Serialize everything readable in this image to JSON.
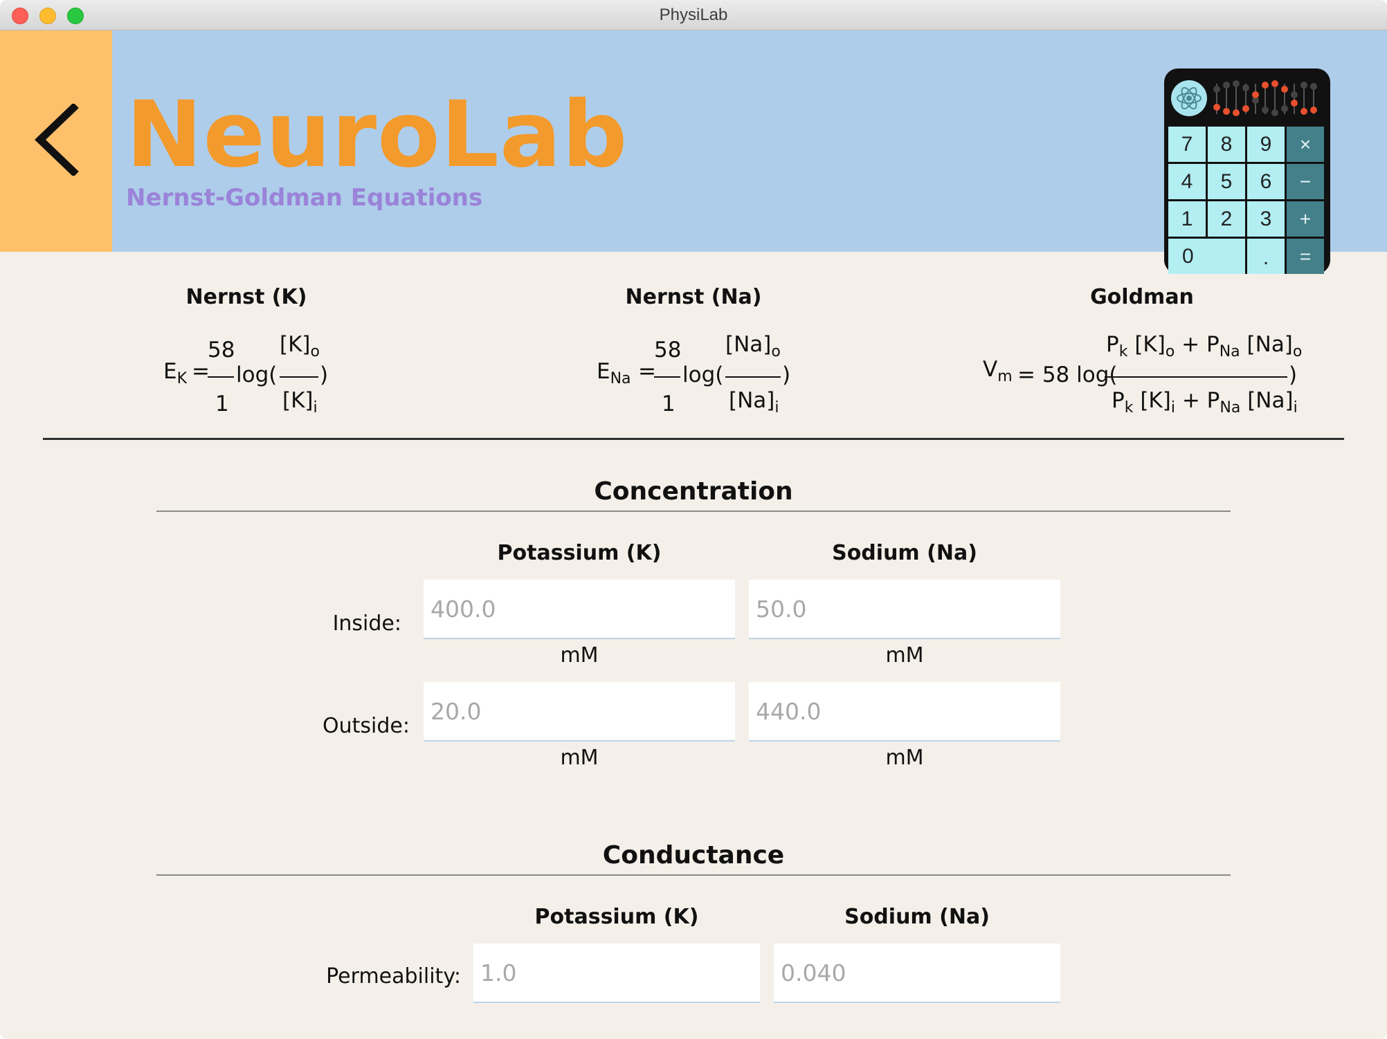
{
  "window": {
    "title": "PhysiLab"
  },
  "header": {
    "app_title": "NeuroLab",
    "subtitle": "Nernst-Goldman Equations",
    "back_icon": "chevron-left-icon",
    "colors": {
      "header_bg": "#aecdea",
      "back_bg": "#fec06b",
      "title": "#f39a2c",
      "subtitle": "#9a83d8"
    }
  },
  "calculator": {
    "icon": "calculator-icon",
    "keys": [
      [
        "7",
        "8",
        "9",
        "×"
      ],
      [
        "4",
        "5",
        "6",
        "−"
      ],
      [
        "1",
        "2",
        "3",
        "+"
      ],
      [
        "0",
        ".",
        "="
      ]
    ]
  },
  "formulas": {
    "nernst_k": {
      "title": "Nernst (K)",
      "lhs": "E",
      "lhs_sub": "K",
      "coef_num": "58",
      "coef_den": "1",
      "log": "log(",
      "close": ")",
      "num": "[K]",
      "num_sub": "o",
      "den": "[K]",
      "den_sub": "i",
      "eq": "="
    },
    "nernst_na": {
      "title": "Nernst (Na)",
      "lhs": "E",
      "lhs_sub": "Na",
      "coef_num": "58",
      "coef_den": "1",
      "log": "log(",
      "close": ")",
      "num": "[Na]",
      "num_sub": "o",
      "den": "[Na]",
      "den_sub": "i",
      "eq": "="
    },
    "goldman": {
      "title": "Goldman",
      "lhs": "V",
      "lhs_sub": "m",
      "rhs": "= 58 log(",
      "close": ")",
      "num": {
        "p1": "P",
        "p1_sub": "k",
        "c1": "[K]",
        "c1_sub": "o",
        "plus": "+",
        "p2": "P",
        "p2_sub": "Na",
        "c2": "[Na]",
        "c2_sub": "o"
      },
      "den": {
        "p1": "P",
        "p1_sub": "k",
        "c1": "[K]",
        "c1_sub": "i",
        "plus": "+",
        "p2": "P",
        "p2_sub": "Na",
        "c2": "[Na]",
        "c2_sub": "i"
      }
    }
  },
  "concentration": {
    "title": "Concentration",
    "col_k": "Potassium (K)",
    "col_na": "Sodium (Na)",
    "inside_label": "Inside:",
    "outside_label": "Outside:",
    "inside_k": "400.0",
    "inside_na": "50.0",
    "outside_k": "20.0",
    "outside_na": "440.0",
    "unit": "mM"
  },
  "conductance": {
    "title": "Conductance",
    "col_k": "Potassium (K)",
    "col_na": "Sodium (Na)",
    "permeability_label": "Permeability:",
    "perm_k": "1.0",
    "perm_na": "0.040"
  }
}
